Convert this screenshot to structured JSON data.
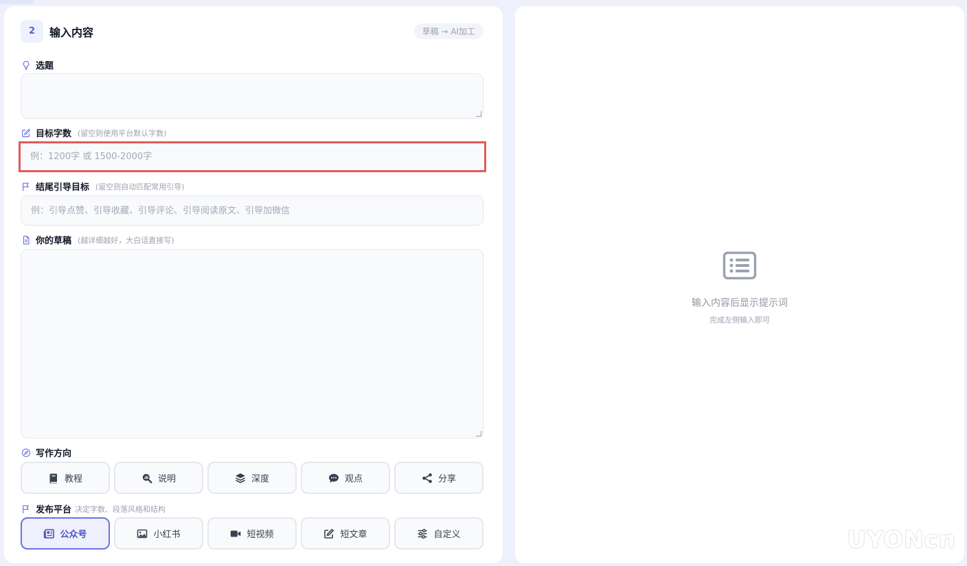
{
  "step": {
    "number": "2",
    "title": "输入内容",
    "mode": "草稿 → AI加工"
  },
  "fields": {
    "topic": {
      "label": "选题",
      "value": ""
    },
    "word_count": {
      "label": "目标字数",
      "hint": "(留空则使用平台默认字数)",
      "placeholder": "例：1200字 或 1500-2000字",
      "value": ""
    },
    "cta": {
      "label": "结尾引导目标",
      "hint": "(留空则自动匹配常用引导)",
      "placeholder": "例：引导点赞、引导收藏、引导评论、引导阅读原文、引导加微信",
      "value": ""
    },
    "draft": {
      "label": "你的草稿",
      "hint": "(越详细越好，大白话直接写)",
      "value": ""
    }
  },
  "direction": {
    "label": "写作方向",
    "options": [
      {
        "label": "教程",
        "icon": "book-icon"
      },
      {
        "label": "说明",
        "icon": "chart-search-icon"
      },
      {
        "label": "深度",
        "icon": "layers-icon"
      },
      {
        "label": "观点",
        "icon": "comment-icon"
      },
      {
        "label": "分享",
        "icon": "share-icon"
      }
    ]
  },
  "platform": {
    "label": "发布平台",
    "hint": "决定字数、段落风格和结构",
    "selected": "公众号",
    "options": [
      {
        "label": "公众号",
        "icon": "newspaper-icon"
      },
      {
        "label": "小红书",
        "icon": "image-icon"
      },
      {
        "label": "短视频",
        "icon": "video-icon"
      },
      {
        "label": "短文章",
        "icon": "edit-icon"
      },
      {
        "label": "自定义",
        "icon": "sliders-icon"
      }
    ]
  },
  "preview": {
    "empty_title": "输入内容后显示提示词",
    "empty_sub": "完成左侧输入即可"
  },
  "watermark": "UYONcn",
  "colors": {
    "accent": "#5561d6",
    "highlight": "#e05a5a",
    "background": "#eef0fb"
  }
}
